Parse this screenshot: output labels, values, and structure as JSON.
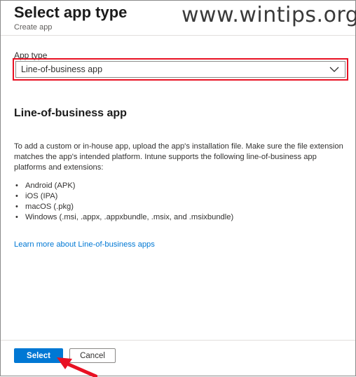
{
  "header": {
    "title": "Select app type",
    "subtitle": "Create app",
    "watermark": "www.wintips.org"
  },
  "app_type": {
    "label": "App type",
    "selected": "Line-of-business app",
    "dropdown_icon": "chevron-down-icon",
    "highlight_color": "#e81123"
  },
  "section": {
    "title": "Line-of-business app",
    "description": "To add a custom or in-house app, upload the app's installation file. Make sure the file extension matches the app's intended platform. Intune supports the following line-of-business app platforms and extensions:",
    "platforms": [
      "Android (APK)",
      "iOS (IPA)",
      "macOS (.pkg)",
      "Windows (.msi, .appx, .appxbundle, .msix, and .msixbundle)"
    ],
    "learn_more": "Learn more about Line-of-business apps"
  },
  "footer": {
    "select_label": "Select",
    "cancel_label": "Cancel",
    "accent_color": "#0078d4",
    "arrow_icon": "red-arrow-icon"
  }
}
